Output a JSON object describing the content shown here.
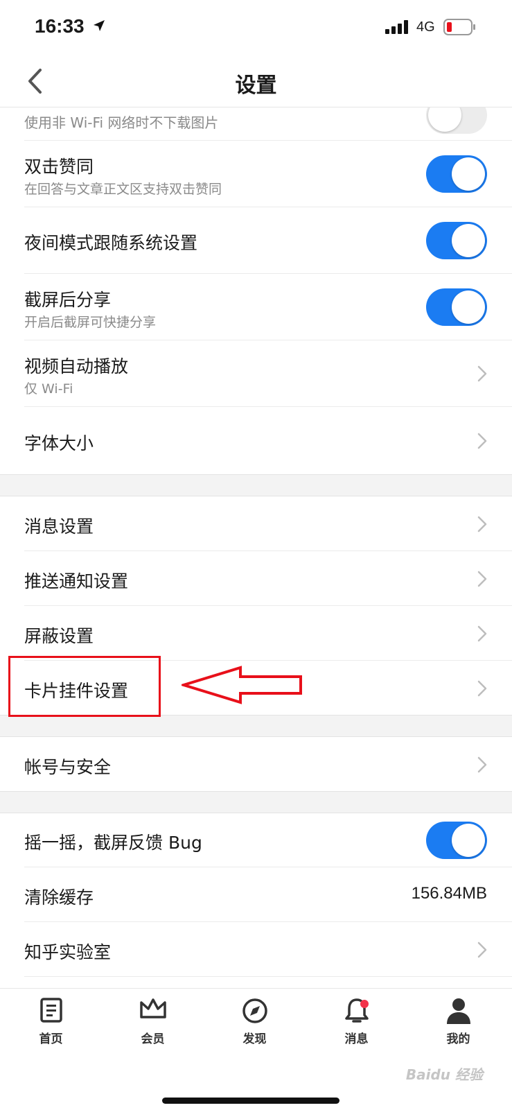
{
  "status_bar": {
    "time": "16:33",
    "network": "4G"
  },
  "nav": {
    "title": "设置"
  },
  "settings": {
    "no_image": {
      "subtitle": "使用非 Wi-Fi 网络时不下载图片"
    },
    "double_tap": {
      "title": "双击赞同",
      "subtitle": "在回答与文章正文区支持双击赞同"
    },
    "night_mode": {
      "title": "夜间模式跟随系统设置"
    },
    "screenshot_share": {
      "title": "截屏后分享",
      "subtitle": "开启后截屏可快捷分享"
    },
    "video_autoplay": {
      "title": "视频自动播放",
      "subtitle": "仅 Wi-Fi"
    },
    "font_size": {
      "title": "字体大小"
    },
    "message_settings": {
      "title": "消息设置"
    },
    "push_settings": {
      "title": "推送通知设置"
    },
    "block_settings": {
      "title": "屏蔽设置"
    },
    "card_widget": {
      "title": "卡片挂件设置"
    },
    "account_security": {
      "title": "帐号与安全"
    },
    "shake_feedback": {
      "title": "摇一摇，截屏反馈 Bug"
    },
    "clear_cache": {
      "title": "清除缓存",
      "value": "156.84MB"
    },
    "lab": {
      "title": "知乎实验室"
    }
  },
  "tabs": [
    {
      "label": "首页",
      "icon": "home-icon"
    },
    {
      "label": "会员",
      "icon": "crown-icon"
    },
    {
      "label": "发现",
      "icon": "compass-icon"
    },
    {
      "label": "消息",
      "icon": "bell-icon"
    },
    {
      "label": "我的",
      "icon": "person-icon"
    }
  ],
  "watermark": "Baidu 经验",
  "colors": {
    "accent": "#1b7cf2",
    "annotation": "#e8101a",
    "badge": "#f2334b"
  }
}
